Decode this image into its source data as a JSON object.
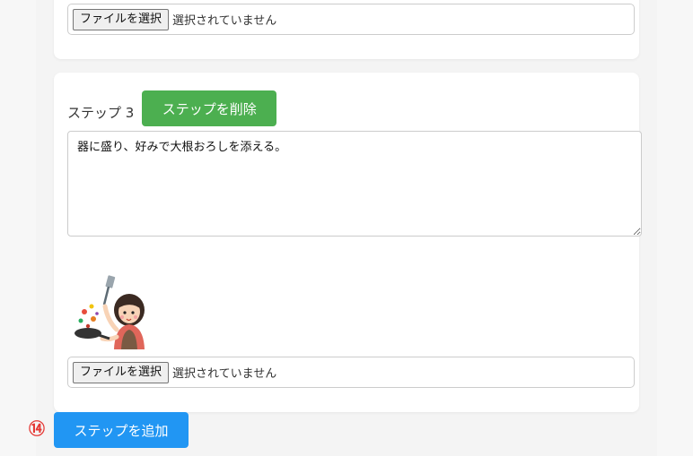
{
  "upload_prev": {
    "button_label": "ファイルを選択",
    "status": "選択されていません"
  },
  "step": {
    "label": "ステップ 3",
    "delete_label": "ステップを削除",
    "text": "器に盛り、好みで大根おろしを添える。",
    "image_icon": "cooking-woman-illustration-icon",
    "upload": {
      "button_label": "ファイルを選択",
      "status": "選択されていません"
    }
  },
  "add_step_label": "ステップを追加",
  "marker": "⑭",
  "colors": {
    "delete_button": "#4caf50",
    "add_button": "#2196f3",
    "marker": "#e53935"
  }
}
